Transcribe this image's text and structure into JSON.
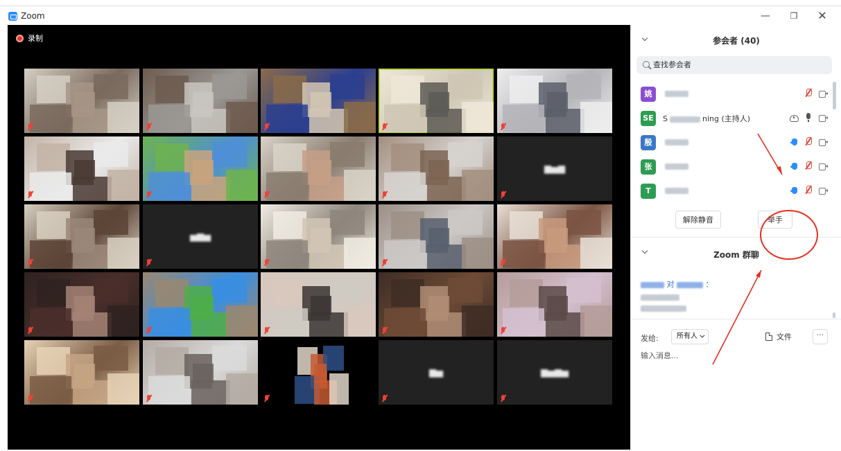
{
  "window": {
    "title": "Zoom",
    "minimize_glyph": "—",
    "maximize_glyph": "❐",
    "close_glyph": "✕"
  },
  "recording": {
    "label": "录制"
  },
  "video_tiles": [
    {
      "name": "",
      "tone": [
        "#7a6a5e",
        "#a69586",
        "#d6cfc4"
      ]
    },
    {
      "name": "",
      "tone": [
        "#9a9894",
        "#c9c6c0",
        "#6d5b4f"
      ]
    },
    {
      "name": "",
      "tone": [
        "#2c3f8f",
        "#d2c6b3",
        "#8a6b4a"
      ]
    },
    {
      "name": "",
      "tone": [
        "#cfc7b4",
        "#5d5a55",
        "#efe8d8"
      ],
      "active": true
    },
    {
      "name": "",
      "tone": [
        "#b4b4b8",
        "#5c5f6a",
        "#ededee"
      ]
    },
    {
      "name": "",
      "tone": [
        "#eaeaea",
        "#4a3a34",
        "#c3b3a6"
      ]
    },
    {
      "name": "",
      "tone": [
        "#4f8fd6",
        "#c9a37d",
        "#6db34e"
      ]
    },
    {
      "name": "",
      "tone": [
        "#8a7d70",
        "#c59f86",
        "#d8d2c8"
      ]
    },
    {
      "name": "",
      "tone": [
        "#d6d2cf",
        "#7c6452",
        "#a38f7f"
      ]
    },
    {
      "name": "",
      "blank": true,
      "center": "▆▅▆"
    },
    {
      "name": "",
      "tone": [
        "#5c4436",
        "#9a8779",
        "#d8d0c2"
      ]
    },
    {
      "name": "",
      "blank": true,
      "center": "▅▆▅"
    },
    {
      "name": "",
      "tone": [
        "#8e867c",
        "#d2c5b6",
        "#f1ece3"
      ]
    },
    {
      "name": "",
      "tone": [
        "#cbc8c6",
        "#58606e",
        "#9c8f86"
      ]
    },
    {
      "name": "",
      "tone": [
        "#7b5443",
        "#c89a7e",
        "#e8dfd6"
      ]
    },
    {
      "name": "",
      "tone": [
        "#4a2e2a",
        "#a48476",
        "#2e2220"
      ]
    },
    {
      "name": "",
      "tone": [
        "#3a8ee0",
        "#4fae48",
        "#9a8770"
      ]
    },
    {
      "name": "",
      "tone": [
        "#cfcac2",
        "#3b3634",
        "#d8c8bd"
      ]
    },
    {
      "name": "",
      "tone": [
        "#6e4b36",
        "#b08d76",
        "#3e2d25"
      ]
    },
    {
      "name": "",
      "tone": [
        "#d3c0cf",
        "#5a4a48",
        "#b59c9a"
      ]
    },
    {
      "name": "",
      "tone": [
        "#7a5c44",
        "#c5a585",
        "#e7d2b5"
      ]
    },
    {
      "name": "",
      "tone": [
        "#dadada",
        "#6a625e",
        "#b4aba3"
      ]
    },
    {
      "name": "",
      "tone": [
        "#2d4f86",
        "#c55a33",
        "#e2d7ca"
      ],
      "partial": true
    },
    {
      "name": "",
      "blank": true,
      "center": "▆▅"
    },
    {
      "name": "",
      "blank": true,
      "center": "▆▅▆▅"
    }
  ],
  "participants_panel": {
    "title": "参会者 (40)",
    "search_placeholder": "查找参会者",
    "participants": [
      {
        "avatar": "姚",
        "color": "#8a4fd1",
        "name": "",
        "suffix": "",
        "icons": [
          "mic-muted",
          "cam"
        ]
      },
      {
        "avatar": "SE",
        "color": "#2e9c52",
        "name": "S",
        "suffix": "ning (主持人)",
        "icons": [
          "cloud",
          "mic-on",
          "cam"
        ]
      },
      {
        "avatar": "殷",
        "color": "#3b78c7",
        "name": "",
        "suffix": "",
        "icons": [
          "hand",
          "mic-muted",
          "cam"
        ]
      },
      {
        "avatar": "张",
        "color": "#2e9c52",
        "name": "",
        "suffix": "",
        "icons": [
          "hand",
          "mic-muted",
          "cam"
        ]
      },
      {
        "avatar": "T",
        "color": "#2e9c52",
        "name": "",
        "suffix": "",
        "icons": [
          "hand",
          "mic-muted",
          "cam"
        ]
      }
    ],
    "unmute_label": "解除静音",
    "raise_hand_label": "举手"
  },
  "chat_panel": {
    "title": "Zoom 群聊",
    "message_middle": "对",
    "message_end": "：",
    "send_to_label": "发给:",
    "send_to_value": "所有人",
    "file_label": "文件",
    "more_label": "···",
    "input_placeholder": "输入消息..."
  },
  "colors": {
    "accent": "#2d8cff",
    "muted_red": "#e5453b",
    "annotation_red": "#e62e1e",
    "active_speaker": "#b7d548"
  }
}
